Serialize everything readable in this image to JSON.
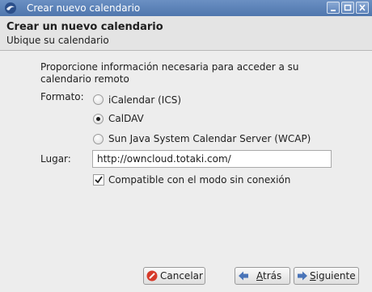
{
  "window": {
    "title": "Crear nuevo calendario",
    "controls": [
      "minimize",
      "maximize",
      "close"
    ]
  },
  "header": {
    "title": "Crear un nuevo calendario",
    "subtitle": "Ubique su calendario"
  },
  "form": {
    "intro": "Proporcione información necesaria para acceder a su calendario remoto",
    "format_label": "Formato:",
    "format_options": [
      {
        "label": "iCalendar (ICS)",
        "checked": false
      },
      {
        "label": "CalDAV",
        "checked": true
      },
      {
        "label": "Sun Java System Calendar Server (WCAP)",
        "checked": false
      }
    ],
    "location_label": "Lugar:",
    "location_value": "http://owncloud.totaki.com/",
    "offline_label": "Compatible con el modo sin conexión",
    "offline_checked": true
  },
  "buttons": {
    "cancel": "Cancelar",
    "back_underlined": "A",
    "back_rest": "trás",
    "next_underlined": "S",
    "next_rest": "iguiente"
  },
  "colors": {
    "titlebar": "#5a80b6",
    "cancel_icon": "#d63a2a",
    "arrow_icon": "#4a74b8"
  }
}
